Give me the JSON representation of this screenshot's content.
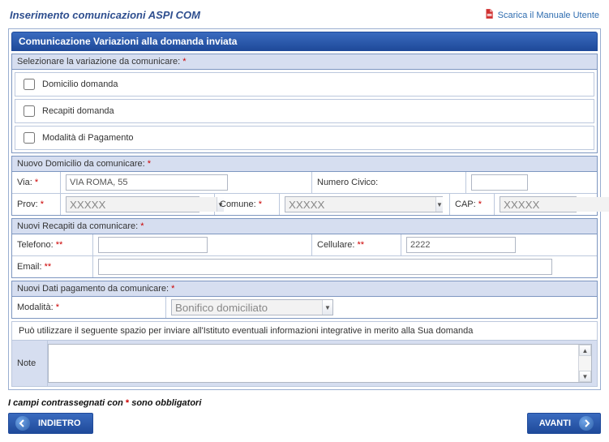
{
  "header": {
    "title": "Inserimento comunicazioni ASPI COM",
    "manual_link": "Scarica il Manuale Utente"
  },
  "panel": {
    "title": "Comunicazione Variazioni alla domanda inviata"
  },
  "sec_variazione": {
    "header": "Selezionare la variazione da comunicare:",
    "opts": [
      {
        "label": "Domicilio domanda"
      },
      {
        "label": "Recapiti domanda"
      },
      {
        "label": "Modalità di Pagamento"
      }
    ]
  },
  "sec_domicilio": {
    "header": "Nuovo Domicilio da comunicare:",
    "via_label": "Via:",
    "via_value": "VIA ROMA, 55",
    "civico_label": "Numero Civico:",
    "civico_value": "",
    "prov_label": "Prov:",
    "prov_value": "XXXXX",
    "comune_label": "Comune:",
    "comune_value": "XXXXX",
    "cap_label": "CAP:",
    "cap_value": "XXXXX"
  },
  "sec_recapiti": {
    "header": "Nuovi Recapiti da comunicare:",
    "telefono_label": "Telefono:",
    "telefono_value": "",
    "cellulare_label": "Cellulare:",
    "cellulare_value": "2222",
    "email_label": "Email:",
    "email_value": ""
  },
  "sec_pagamento": {
    "header": "Nuovi Dati pagamento da comunicare:",
    "modalita_label": "Modalità:",
    "modalita_value": "Bonifico domiciliato"
  },
  "info_hint": "Può utilizzare il seguente spazio per inviare all'Istituto eventuali informazioni integrative in merito alla Sua domanda",
  "note_label": "Note",
  "note_value": "",
  "footer_note_pre": "I campi contrassegnati con ",
  "footer_note_post": " sono obbligatori",
  "buttons": {
    "back": "INDIETRO",
    "next": "AVANTI"
  },
  "asterisk": "*",
  "double_asterisk": "**"
}
